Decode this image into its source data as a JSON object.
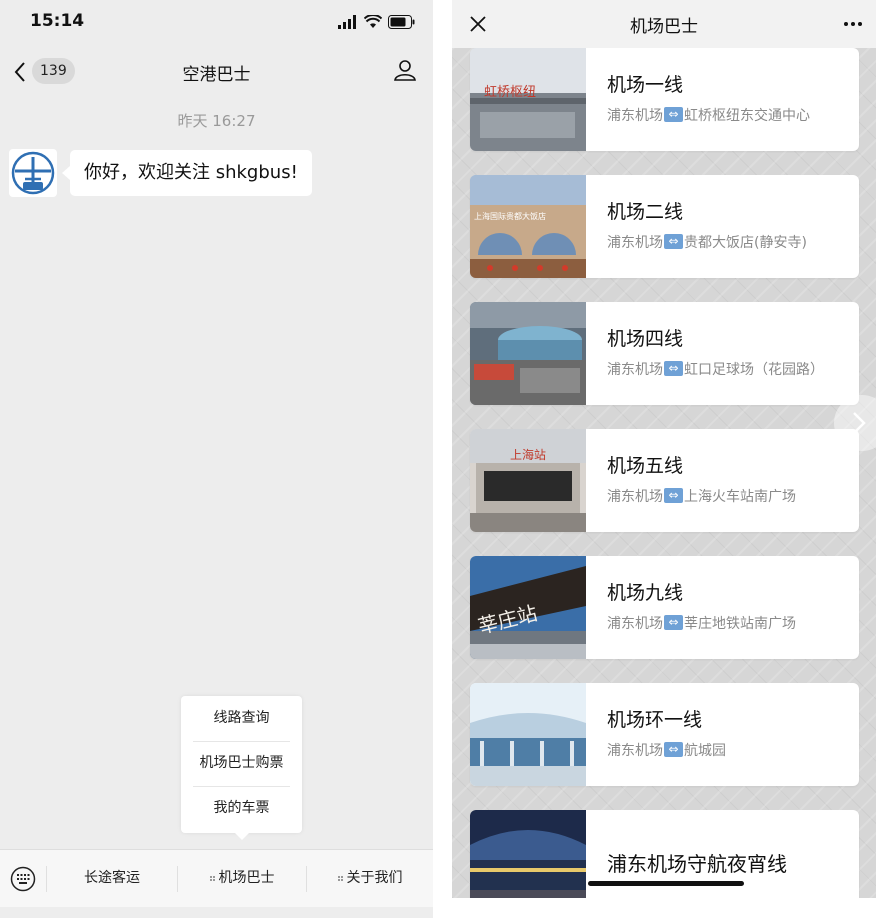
{
  "chat": {
    "status_time": "15:14",
    "back_badge": "139",
    "title": "空港巴士",
    "timestamp": "昨天 16:27",
    "message": "你好，欢迎关注 shkgbus!",
    "submenu": [
      "线路查询",
      "机场巴士购票",
      "我的车票"
    ],
    "menu": [
      "长途客运",
      "机场巴士",
      "关于我们"
    ],
    "avatar_text": "BUS"
  },
  "page": {
    "title": "机场巴士",
    "cards": [
      {
        "name": "机场一线",
        "from": "浦东机场",
        "to": "虹桥枢纽东交通中心",
        "thumb_text": "虹桥枢纽"
      },
      {
        "name": "机场二线",
        "from": "浦东机场",
        "to": "贵都大饭店(静安寺)",
        "thumb_text": "上海国际贵都大饭店"
      },
      {
        "name": "机场四线",
        "from": "浦东机场",
        "to": "虹口足球场（花园路）"
      },
      {
        "name": "机场五线",
        "from": "浦东机场",
        "to": "上海火车站南广场",
        "thumb_text": "上海站"
      },
      {
        "name": "机场九线",
        "from": "浦东机场",
        "to": "莘庄地铁站南广场",
        "thumb_text": "莘庄站"
      },
      {
        "name": "机场环一线",
        "from": "浦东机场",
        "to": "航城园"
      },
      {
        "name": "浦东机场守航夜宵线"
      }
    ]
  },
  "colors": {
    "chat_bg": "#ededed",
    "route_arrow": "#6fa1d6",
    "logo_blue": "#2f6fb3"
  }
}
